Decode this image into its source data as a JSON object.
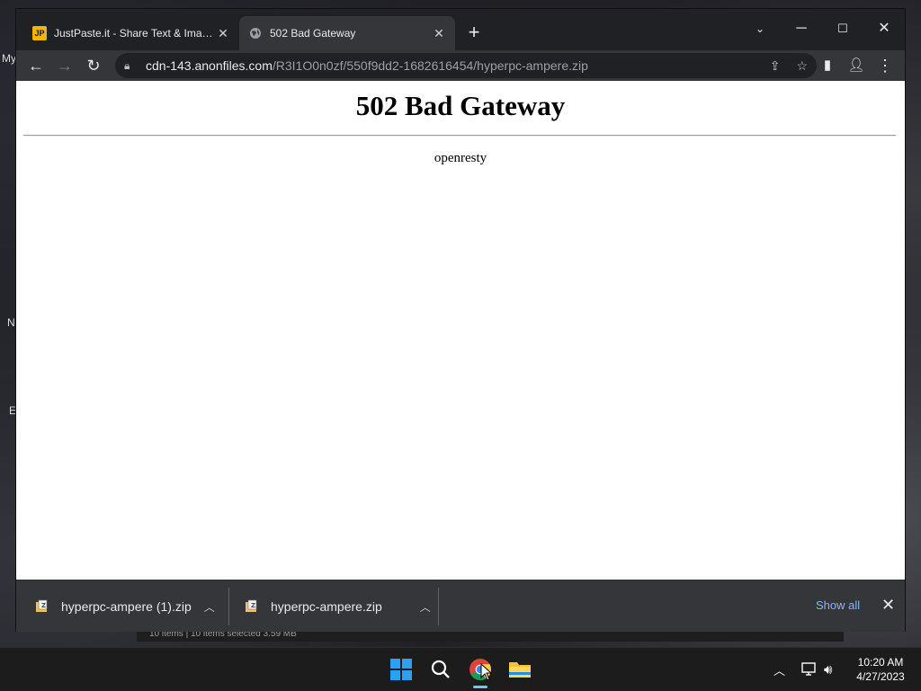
{
  "desktop": {
    "labels": [
      "My",
      "N",
      "E"
    ]
  },
  "browser": {
    "tabs": [
      {
        "title": "JustPaste.it - Share Text & Images",
        "favicon": "JP",
        "active": false
      },
      {
        "title": "502 Bad Gateway",
        "favicon": "globe-icon",
        "active": true
      }
    ],
    "url_host": "cdn-143.anonfiles.com",
    "url_path": "/R3I1O0n0zf/550f9dd2-1682616454/hyperpc-ampere.zip"
  },
  "page": {
    "heading": "502 Bad Gateway",
    "server": "openresty"
  },
  "downloads": {
    "items": [
      {
        "filename": "hyperpc-ampere (1).zip"
      },
      {
        "filename": "hyperpc-ampere.zip"
      }
    ],
    "show_all": "Show all"
  },
  "explorer_status": "10 items  |  10 items selected  3.59 MB",
  "taskbar": {
    "time": "10:20 AM",
    "date": "4/27/2023"
  }
}
